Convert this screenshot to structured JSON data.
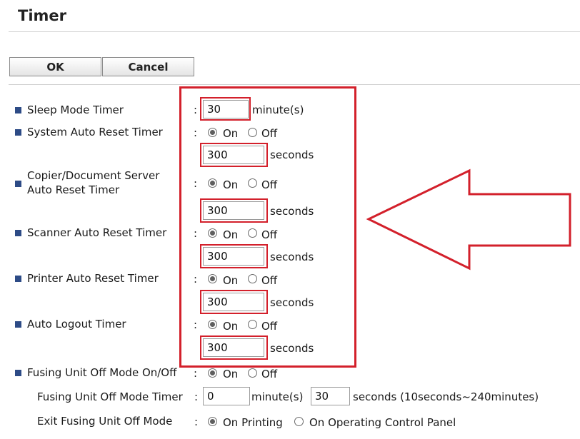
{
  "page": {
    "title": "Timer"
  },
  "buttons": {
    "ok": "OK",
    "cancel": "Cancel"
  },
  "colon": ":",
  "radio": {
    "on": "On",
    "off": "Off"
  },
  "units": {
    "minutes": "minute(s)",
    "seconds": "seconds",
    "range": "seconds (10seconds~240minutes)"
  },
  "settings": {
    "sleep": {
      "label": "Sleep Mode Timer",
      "value": "30"
    },
    "system_reset": {
      "label": "System Auto Reset Timer",
      "state": "On",
      "value": "300"
    },
    "copier_reset": {
      "label1": "Copier/Document Server",
      "label2": "Auto Reset Timer",
      "state": "On",
      "value": "300"
    },
    "scanner_reset": {
      "label": "Scanner Auto Reset Timer",
      "state": "On",
      "value": "300"
    },
    "printer_reset": {
      "label": "Printer Auto Reset Timer",
      "state": "On",
      "value": "300"
    },
    "auto_logout": {
      "label": "Auto Logout Timer",
      "state": "On",
      "value": "300"
    },
    "fusing_mode": {
      "label": "Fusing Unit Off Mode On/Off",
      "state": "On"
    },
    "fusing_timer": {
      "label": "Fusing Unit Off Mode Timer",
      "minutes": "0",
      "seconds": "30"
    },
    "exit_fusing": {
      "label": "Exit Fusing Unit Off Mode",
      "option1": "On Printing",
      "option2": "On Operating Control Panel",
      "selected": "On Printing"
    }
  },
  "annotation": {
    "highlight_color": "#d3202b",
    "arrow": "left-arrow"
  }
}
